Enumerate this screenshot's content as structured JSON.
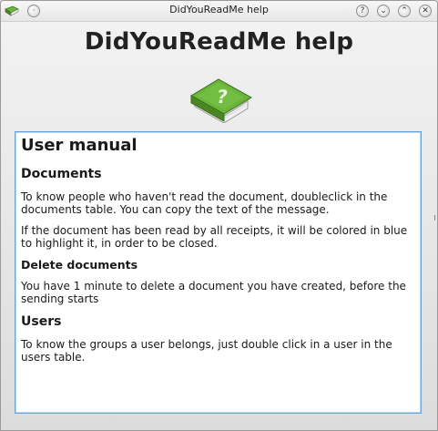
{
  "window": {
    "title": "DidYouReadMe help",
    "buttons": {
      "menu": "·",
      "help": "?",
      "minimize": "⌄",
      "maximize": "⌃",
      "close": "✕"
    }
  },
  "header": {
    "title": "DidYouReadMe help",
    "logo_icon": "green-book-question-icon"
  },
  "manual": {
    "title": "User manual",
    "sections": [
      {
        "heading": "Documents",
        "paragraphs": [
          "To know people who haven't read the document, doubleclick in the documents table. You can copy the text of the message.",
          "If the document has been read by all receipts, it will be colored in blue to highlight it, in order to be closed."
        ]
      },
      {
        "heading": "Delete documents",
        "paragraphs": [
          "You have 1 minute to delete a document you have created, before the sending starts"
        ]
      },
      {
        "heading": "Users",
        "paragraphs": [
          "To know the groups a user belongs, just double click in a user in the users table."
        ]
      }
    ]
  },
  "colors": {
    "book_green": "#5a9a2a",
    "focus_border": "#6aa3d8"
  }
}
